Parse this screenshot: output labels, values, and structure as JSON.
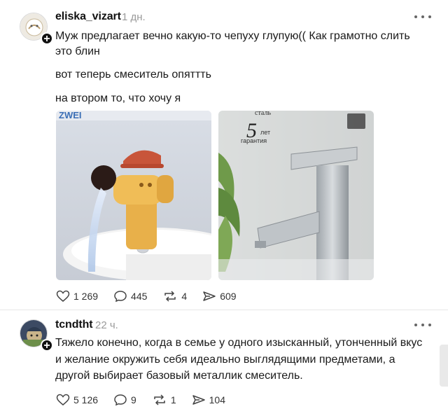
{
  "posts": [
    {
      "username": "eliska_vizart",
      "time": "1 дн.",
      "lines": [
        "Муж предлагает вечно какую-то чепуху глупую(( Как грамотно слить это блин",
        "вот теперь смеситель опяттть",
        "на втором то, что хочу я"
      ],
      "images": [
        {
          "icon": "cartoon-faucet-image",
          "overlay_text": "ZWEI"
        },
        {
          "icon": "steel-faucet-image",
          "overlay_top": "сталь",
          "overlay_big": "5",
          "overlay_small1": "лет",
          "overlay_small2": "гарантия"
        }
      ],
      "stats": {
        "likes": "1 269",
        "comments": "445",
        "reposts": "4",
        "shares": "609"
      }
    },
    {
      "username": "tcndtht",
      "time": "22 ч.",
      "lines": [
        "Тяжело конечно, когда в семье у одного изысканный, утонченный вкус и желание окружить себя идеально выглядящими предметами, а другой выбирает базовый металлик смеситель."
      ],
      "stats": {
        "likes": "5 126",
        "comments": "9",
        "reposts": "1",
        "shares": "104"
      }
    }
  ],
  "colors": {
    "text": "#1a1a1a",
    "muted": "#9a9a9a",
    "icon": "#333333",
    "faucet_orange": "#e8b04a",
    "cap_red": "#c8553a"
  }
}
